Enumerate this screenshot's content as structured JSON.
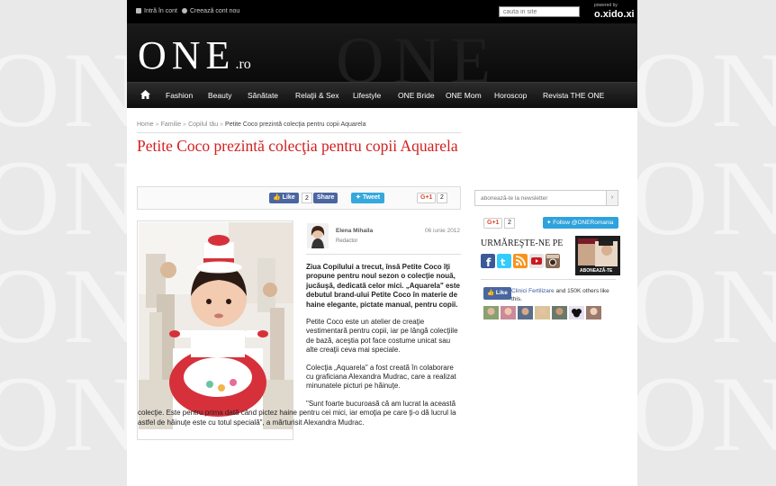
{
  "topbar": {
    "login_label": "Intră în cont",
    "register_label": "Creează cont nou",
    "search_placeholder": "cauta in site",
    "powered_label": "powered by",
    "powered_brand": "o.xido.xi"
  },
  "header": {
    "logo_main": "ONE",
    "logo_suffix": ".ro"
  },
  "nav": {
    "items": [
      "Fashion",
      "Beauty",
      "Sănătate",
      "Relaţii & Sex",
      "Lifestyle",
      "ONE Bride",
      "ONE Mom",
      "Horoscop",
      "Revista THE ONE"
    ]
  },
  "breadcrumb": {
    "items": [
      "Home",
      "Familie",
      "Copilul tău"
    ],
    "separator": "»",
    "current": "Petite Coco prezintă colecţia pentru copii Aquarela"
  },
  "article": {
    "title": "Petite Coco prezintă colecţia pentru copii Aquarela",
    "share": {
      "fb_like_label": "Like",
      "fb_like_count": "2",
      "fb_share_label": "Share",
      "tweet_label": "Tweet",
      "gplus_label": "G+1",
      "gplus_count": "2"
    },
    "author_name": "Elena Mihaila",
    "author_role": "Redactor",
    "date": "06 iunie 2012",
    "lead": "Ziua Copilului a trecut, însă Petite Coco îţi propune pentru noul sezon o colecţie nouă, jucăuşă, dedicată celor mici. „Aquarela\" este debutul brand-ului Petite Coco în materie de haine elegante, pictate manual, pentru copii.",
    "paragraphs": [
      "Petite Coco este un atelier de creaţie vestimentară pentru copii, iar pe lângă colecţiile de bază, aceştia pot face costume unicat sau alte creaţii ceva mai speciale.",
      "Colecţia „Aquarela\" a fost creată în colaborare cu graficiana Alexandra Mudrac, care a realizat minunatele picturi pe hăinuţe.",
      "\"Sunt foarte bucuroasă că am lucrat la această colecţie. Este pentru prima dată când pictez haine pentru cei mici, iar emoţia pe care ţi-o dă lucrul la astfel de hăinuţe este cu totul specială\", a mărturisit Alexandra Mudrac."
    ]
  },
  "sidebar": {
    "newsletter_placeholder": "abonează-te la newsletter",
    "newsletter_button": "›",
    "gplus_label": "G+1",
    "gplus_count": "2",
    "twitter_follow_label": "Follow @ONERomania",
    "follow_title": "URMĂREŞTE-NE PE",
    "promo_label": "ABONEAZĂ-TE",
    "social_icons": [
      "facebook-icon",
      "twitter-icon",
      "rss-icon",
      "youtube-icon",
      "instagram-icon"
    ],
    "fb_widget": {
      "like_label": "Like",
      "friends_link": "Clinici Fertilizare",
      "friends_text": " and 150K others like this."
    }
  },
  "colors": {
    "title_red": "#d32020",
    "facebook_blue": "#4a66a0",
    "twitter_blue": "#35a8dd",
    "gplus_red": "#dd4b39"
  }
}
